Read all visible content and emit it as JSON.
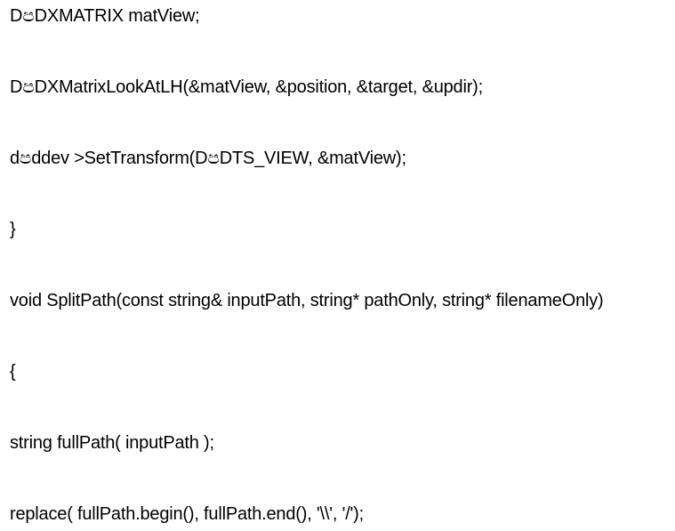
{
  "document": {
    "lines": [
      "DපDXMATRIX matView;",
      "DපDXMatrixLookAtLH(&matView, &position, &target, &updir);",
      "dපddev >SetTransform(DපDTS_VIEW, &matView);",
      "}",
      "void SplitPath(const string& inputPath, string* pathOnly, string* filenameOnly)",
      "{",
      "string fullPath( inputPath );",
      "replace( fullPath.begin(), fullPath.end(), '\\\\', '/');"
    ]
  }
}
